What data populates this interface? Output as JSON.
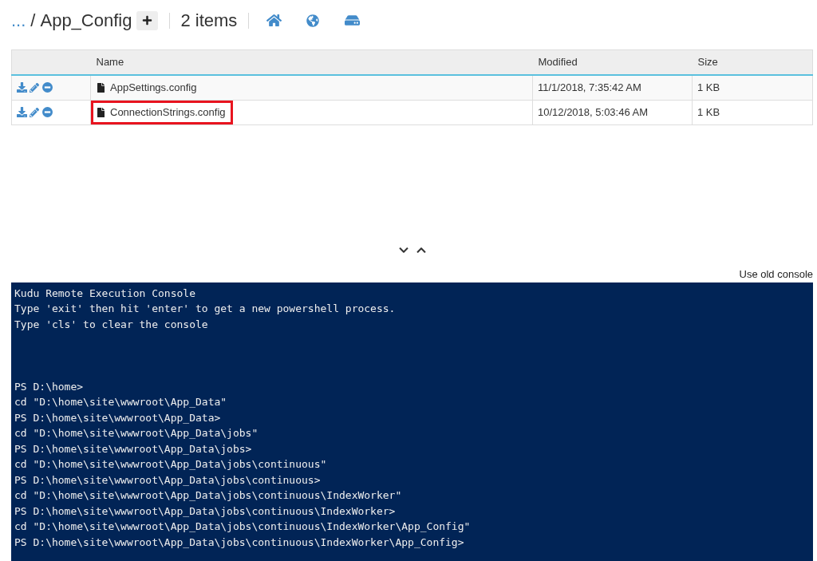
{
  "breadcrumb": {
    "parent_link": "...",
    "separator": "/",
    "current_folder": "App_Config",
    "item_count": "2 items"
  },
  "table": {
    "columns": [
      "Name",
      "Modified",
      "Size"
    ],
    "rows": [
      {
        "name": "AppSettings.config",
        "modified": "11/1/2018, 7:35:42 AM",
        "size": "1 KB",
        "highlighted": false
      },
      {
        "name": "ConnectionStrings.config",
        "modified": "10/12/2018, 5:03:46 AM",
        "size": "1 KB",
        "highlighted": true
      }
    ]
  },
  "console_switch_link": "Use old console",
  "console": {
    "banner_lines": [
      "Kudu Remote Execution Console",
      "Type 'exit' then hit 'enter' to get a new powershell process.",
      "Type 'cls' to clear the console"
    ],
    "session_lines": [
      "PS D:\\home>",
      "cd \"D:\\home\\site\\wwwroot\\App_Data\"",
      "PS D:\\home\\site\\wwwroot\\App_Data>",
      "cd \"D:\\home\\site\\wwwroot\\App_Data\\jobs\"",
      "PS D:\\home\\site\\wwwroot\\App_Data\\jobs>",
      "cd \"D:\\home\\site\\wwwroot\\App_Data\\jobs\\continuous\"",
      "PS D:\\home\\site\\wwwroot\\App_Data\\jobs\\continuous>",
      "cd \"D:\\home\\site\\wwwroot\\App_Data\\jobs\\continuous\\IndexWorker\"",
      "PS D:\\home\\site\\wwwroot\\App_Data\\jobs\\continuous\\IndexWorker>",
      "cd \"D:\\home\\site\\wwwroot\\App_Data\\jobs\\continuous\\IndexWorker\\App_Config\"",
      "PS D:\\home\\site\\wwwroot\\App_Data\\jobs\\continuous\\IndexWorker\\App_Config>"
    ]
  }
}
